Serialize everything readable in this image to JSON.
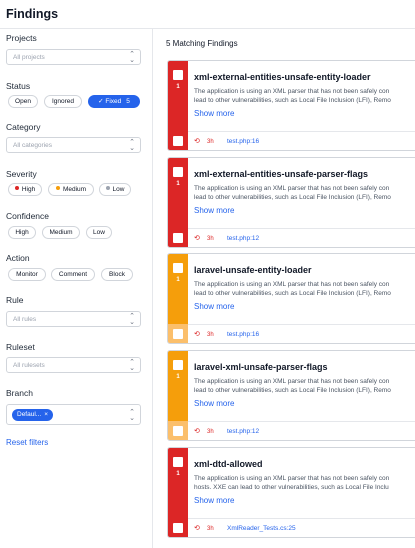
{
  "header": {
    "title": "Findings"
  },
  "filters": {
    "projects": {
      "label": "Projects",
      "placeholder": "All projects"
    },
    "status": {
      "label": "Status",
      "options": [
        "Open",
        "Ignored",
        "Fixed"
      ],
      "fixed_count": "5",
      "active": "Fixed"
    },
    "category": {
      "label": "Category",
      "placeholder": "All categories"
    },
    "severity": {
      "label": "Severity",
      "options": [
        "High",
        "Medium",
        "Low"
      ],
      "colors": [
        "#dc2626",
        "#f59e0b",
        "#9ca3af"
      ]
    },
    "confidence": {
      "label": "Confidence",
      "options": [
        "High",
        "Medium",
        "Low"
      ]
    },
    "action": {
      "label": "Action",
      "options": [
        "Monitor",
        "Comment",
        "Block"
      ]
    },
    "rule": {
      "label": "Rule",
      "placeholder": "All rules"
    },
    "ruleset": {
      "label": "Ruleset",
      "placeholder": "All rulesets"
    },
    "branch": {
      "label": "Branch",
      "selected": "Defaul...",
      "remove": "×"
    },
    "reset": "Reset filters"
  },
  "results": {
    "count_label": "5 Matching Findings",
    "findings": [
      {
        "rule": "xml-external-entities-unsafe-entity-loader",
        "desc1": "The application is using an XML parser that has not been safely con",
        "desc2": "lead to other vulnerabilities, such as Local File Inclusion (LFI), Remo",
        "more": "Show more",
        "severity_color": "#dc2626",
        "foot_color": "#dc2626",
        "count": "1",
        "age": "3h",
        "location": "test.php:16"
      },
      {
        "rule": "xml-external-entities-unsafe-parser-flags",
        "desc1": "The application is using an XML parser that has not been safely con",
        "desc2": "lead to other vulnerabilities, such as Local File Inclusion (LFI), Remo",
        "more": "Show more",
        "severity_color": "#dc2626",
        "foot_color": "#dc2626",
        "count": "1",
        "age": "3h",
        "location": "test.php:12"
      },
      {
        "rule": "laravel-unsafe-entity-loader",
        "desc1": "The application is using an XML parser that has not been safely con",
        "desc2": "lead to other vulnerabilities, such as Local File Inclusion (LFI), Remo",
        "more": "Show more",
        "severity_color": "#f59e0b",
        "foot_color": "#fbbf6b",
        "count": "1",
        "age": "3h",
        "location": "test.php:16"
      },
      {
        "rule": "laravel-xml-unsafe-parser-flags",
        "desc1": "The application is using an XML parser that has not been safely con",
        "desc2": "lead to other vulnerabilities, such as Local File Inclusion (LFI), Remo",
        "more": "Show more",
        "severity_color": "#f59e0b",
        "foot_color": "#fbbf6b",
        "count": "1",
        "age": "3h",
        "location": "test.php:12"
      },
      {
        "rule": "xml-dtd-allowed",
        "desc1": "The application is using an XML parser that has not been safely con",
        "desc2": "hosts. XXE can lead to other vulnerabilities, such as Local File Inclu",
        "more": "Show more",
        "severity_color": "#dc2626",
        "foot_color": "#dc2626",
        "count": "1",
        "age": "3h",
        "location": "XmlReader_Tests.cs:25"
      }
    ]
  },
  "icons": {
    "select_caret": "chevron-up-down-icon",
    "history": "history-icon"
  }
}
